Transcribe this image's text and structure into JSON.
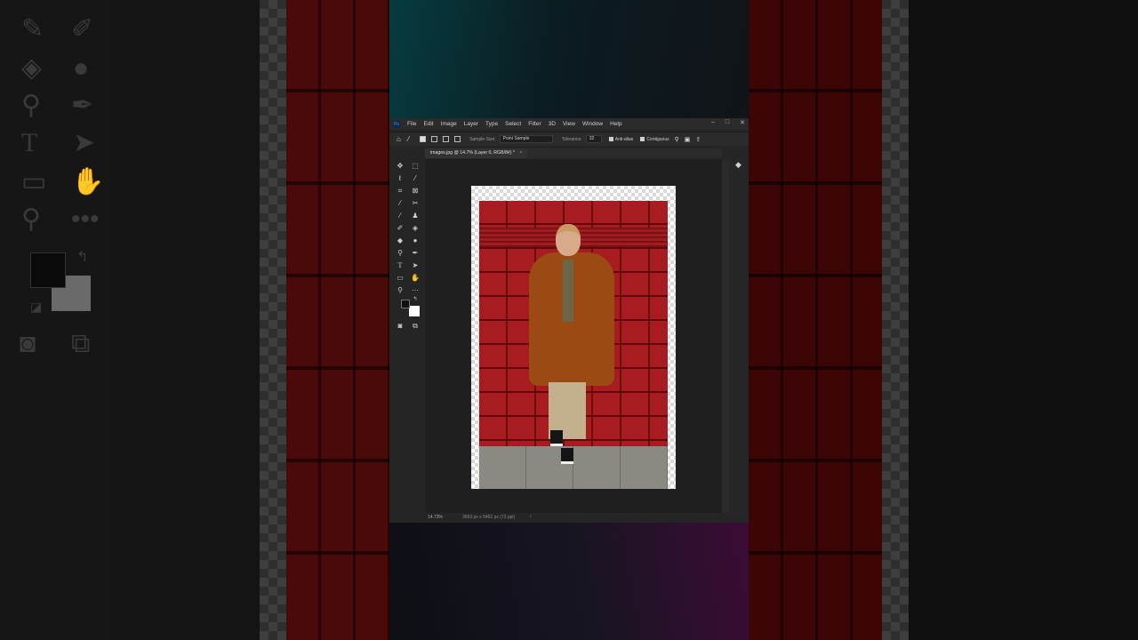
{
  "menubar": {
    "app_badge": "Ps",
    "items": [
      "File",
      "Edit",
      "Image",
      "Layer",
      "Type",
      "Select",
      "Filter",
      "3D",
      "View",
      "Window",
      "Help"
    ],
    "window_controls": [
      "–",
      "□",
      "✕"
    ]
  },
  "options_bar": {
    "sample_size_label": "Sample Size:",
    "sample_size_value": "Point Sample",
    "tolerance_label": "Tolerance:",
    "tolerance_value": "32",
    "anti_alias_label": "Anti-alias",
    "contiguous_label": "Contiguous"
  },
  "document_tab": {
    "title": "images.jpg @ 14.7% (Layer 0, RGB/8#) *",
    "close": "×"
  },
  "status_bar": {
    "zoom": "14.73%",
    "doc_info": "3693 px x 5462 px (72 ppi)",
    "arrow": "›"
  },
  "toolbar_icons": [
    "move-icon",
    "marquee-icon",
    "lasso-icon",
    "magic-wand-icon",
    "crop-icon",
    "frame-icon",
    "eyedropper-icon",
    "healing-icon",
    "brush-icon",
    "stamp-icon",
    "history-brush-icon",
    "eraser-icon",
    "gradient-icon",
    "blur-icon",
    "dodge-icon",
    "pen-icon",
    "type-icon",
    "path-select-icon",
    "rectangle-icon",
    "hand-icon",
    "zoom-icon",
    "more-icon"
  ],
  "colors": {
    "foreground": "#111111",
    "background": "#ffffff",
    "accent": "#31a8ff"
  }
}
